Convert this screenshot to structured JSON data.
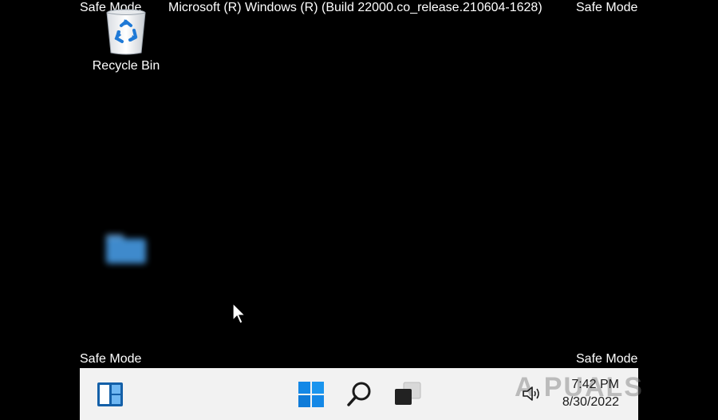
{
  "overlay": {
    "safe_mode_top_left": "Safe Mode",
    "safe_mode_top_right": "Safe Mode",
    "safe_mode_bottom_left": "Safe Mode",
    "safe_mode_bottom_right": "Safe Mode",
    "build_string": "Microsoft (R) Windows (R) (Build 22000.co_release.210604-1628)"
  },
  "desktop": {
    "icons": [
      {
        "label": "Recycle Bin",
        "icon": "recycle-bin-icon"
      },
      {
        "label": "",
        "icon": "folder-icon",
        "blurred": true
      }
    ]
  },
  "taskbar": {
    "items": [
      {
        "name": "widgets",
        "icon": "widgets-icon"
      },
      {
        "name": "start",
        "icon": "windows-logo-icon"
      },
      {
        "name": "search",
        "icon": "search-icon"
      },
      {
        "name": "task-view",
        "icon": "task-view-icon"
      }
    ],
    "tray": {
      "volume_icon": "volume-icon",
      "time": "7:42 PM",
      "date": "8/30/2022"
    },
    "watermark": "A PUALS"
  },
  "colors": {
    "desktop_background": "#000000",
    "taskbar_background": "#f2f2f2",
    "accent": "#0a6fd6"
  }
}
